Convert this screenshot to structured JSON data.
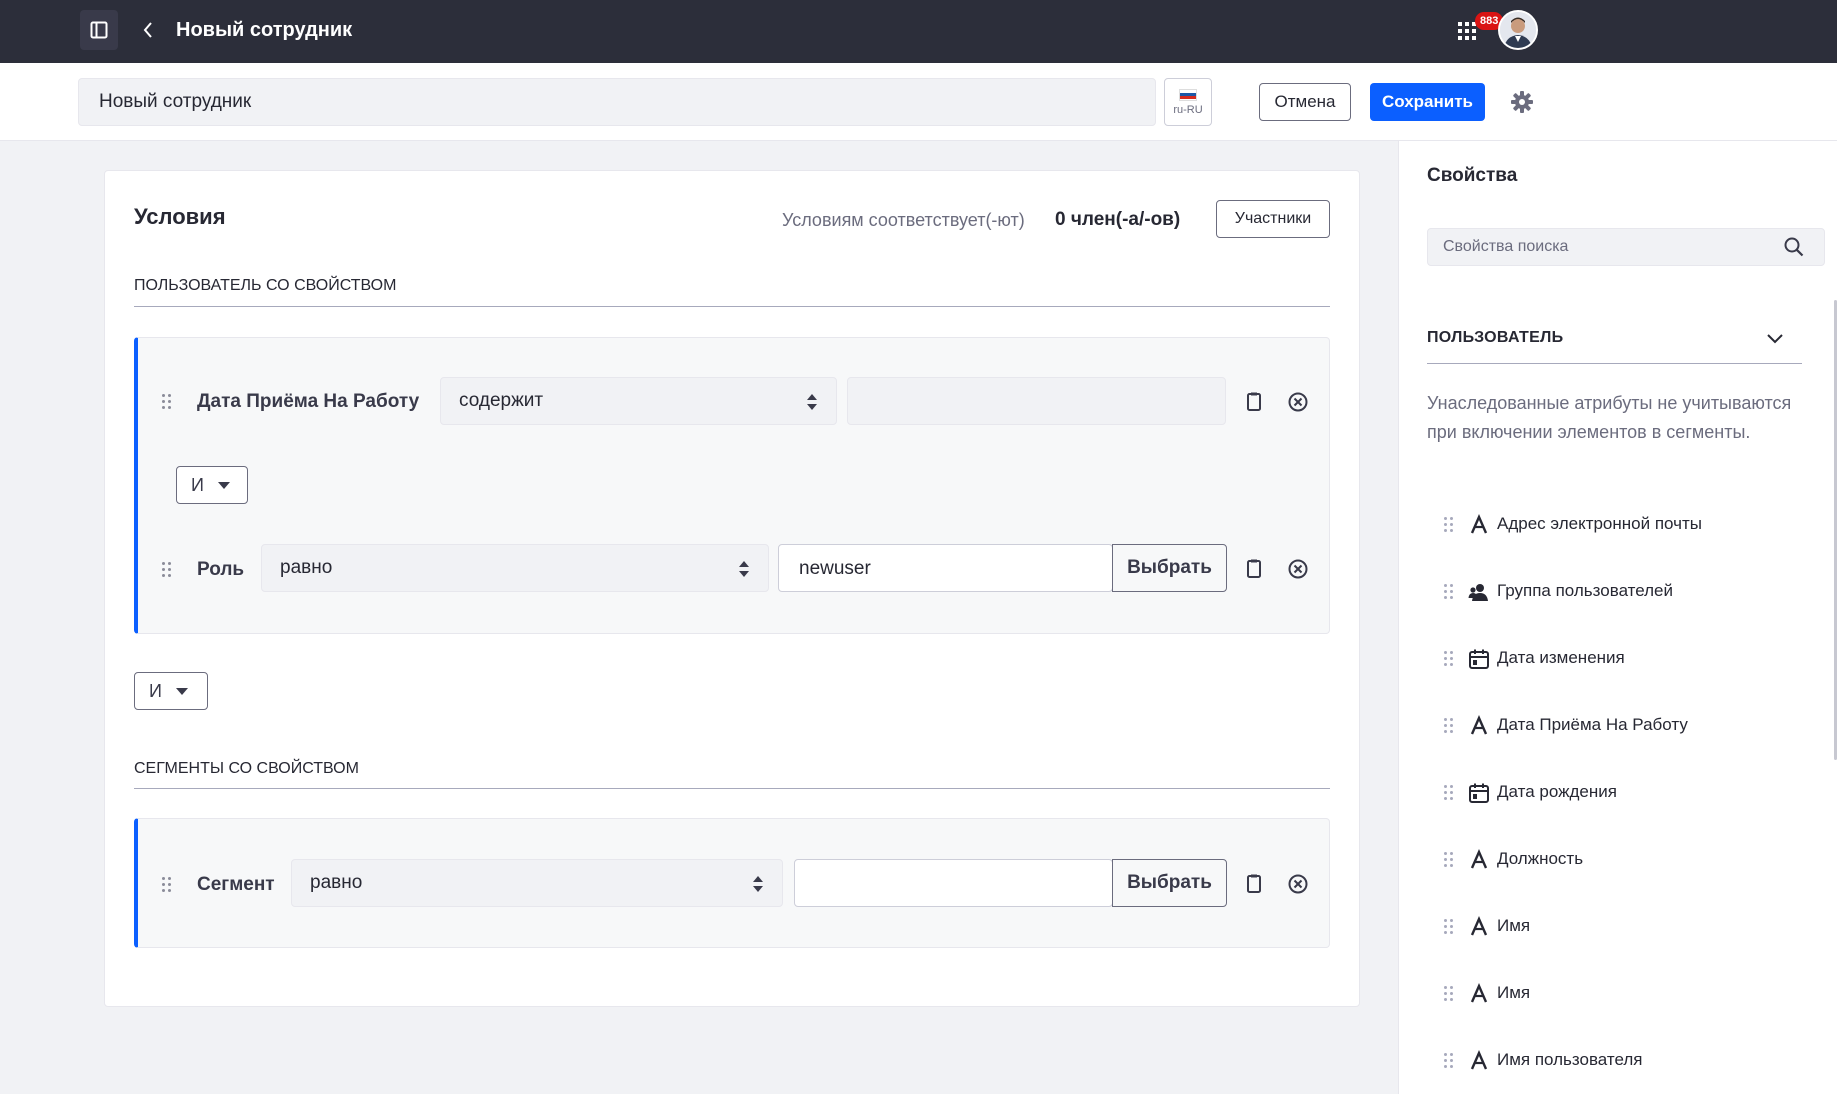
{
  "topbar": {
    "title": "Новый сотрудник",
    "notification_count": "883"
  },
  "header": {
    "name_value": "Новый сотрудник",
    "language_code": "ru-RU",
    "cancel_label": "Отмена",
    "save_label": "Сохранить"
  },
  "conditions": {
    "title": "Условия",
    "match_text": "Условиям соответствует(-ют)",
    "match_count": "0 член(-а/-ов)",
    "members_label": "Участники",
    "user_section": {
      "title": "ПОЛЬЗОВАТЕЛЬ СО СВОЙСТВОМ",
      "rules": [
        {
          "label": "Дата Приёма На Работу",
          "operator": "содержит",
          "value": ""
        },
        {
          "label": "Роль",
          "operator": "равно",
          "value": "newuser",
          "pick_label": "Выбрать"
        }
      ],
      "inner_conjunction": "И"
    },
    "outer_conjunction": "И",
    "segment_section": {
      "title": "СЕГМЕНТЫ СО СВОЙСТВОМ",
      "rules": [
        {
          "label": "Сегмент",
          "operator": "равно",
          "value": "",
          "pick_label": "Выбрать"
        }
      ]
    }
  },
  "properties": {
    "title": "Свойства",
    "search_placeholder": "Свойства поиска",
    "section_title": "ПОЛЬЗОВАТЕЛЬ",
    "note": "Унаследованные атрибуты не учитываются при включении элементов в сегменты.",
    "items": [
      {
        "label": "Адрес электронной почты",
        "icon": "text-icon"
      },
      {
        "label": "Группа пользователей",
        "icon": "users-icon"
      },
      {
        "label": "Дата изменения",
        "icon": "calendar-icon"
      },
      {
        "label": "Дата Приёма На Работу",
        "icon": "text-icon"
      },
      {
        "label": "Дата рождения",
        "icon": "calendar-icon"
      },
      {
        "label": "Должность",
        "icon": "text-icon"
      },
      {
        "label": "Имя",
        "icon": "text-icon"
      },
      {
        "label": "Имя",
        "icon": "text-icon"
      },
      {
        "label": "Имя пользователя",
        "icon": "text-icon"
      }
    ]
  },
  "colors": {
    "primary": "#0b5fff",
    "topbar": "#2c2e3a",
    "badge": "#da1414"
  }
}
